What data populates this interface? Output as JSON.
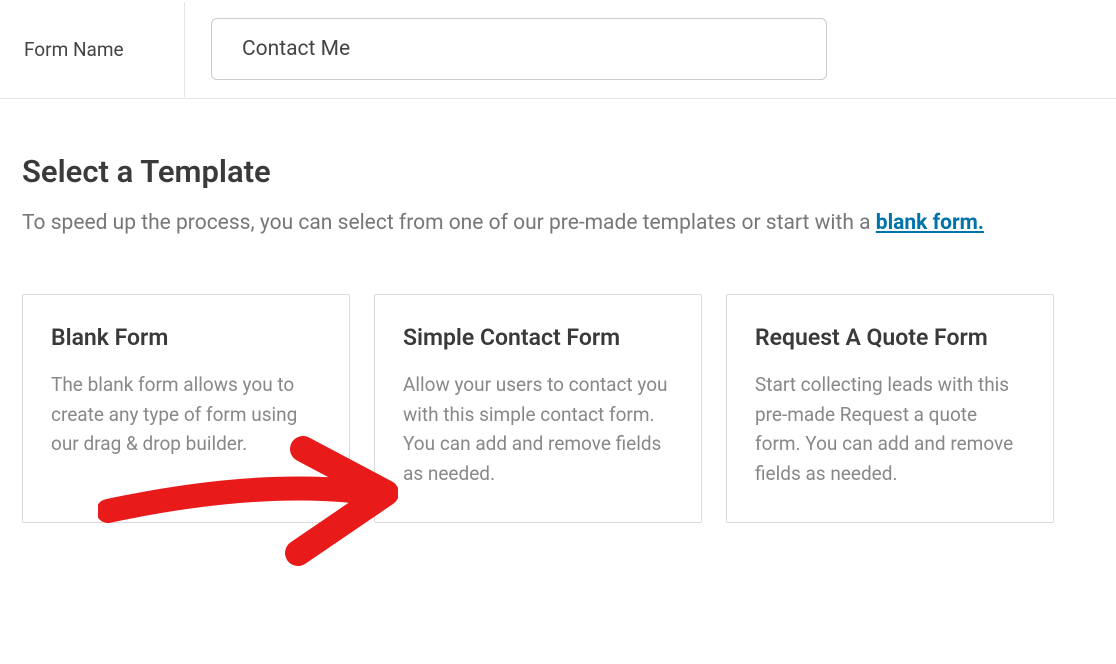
{
  "form_name": {
    "label": "Form Name",
    "value": "Contact Me"
  },
  "select_template": {
    "title": "Select a Template",
    "desc_prefix": "To speed up the process, you can select from one of our pre-made templates or start with a ",
    "blank_link_text": "blank form."
  },
  "templates": [
    {
      "title": "Blank Form",
      "desc": "The blank form allows you to create any type of form using our drag & drop builder."
    },
    {
      "title": "Simple Contact Form",
      "desc": "Allow your users to contact you with this simple contact form. You can add and remove fields as needed."
    },
    {
      "title": "Request A Quote Form",
      "desc": "Start collecting leads with this pre-made Request a quote form. You can add and remove fields as needed."
    }
  ]
}
